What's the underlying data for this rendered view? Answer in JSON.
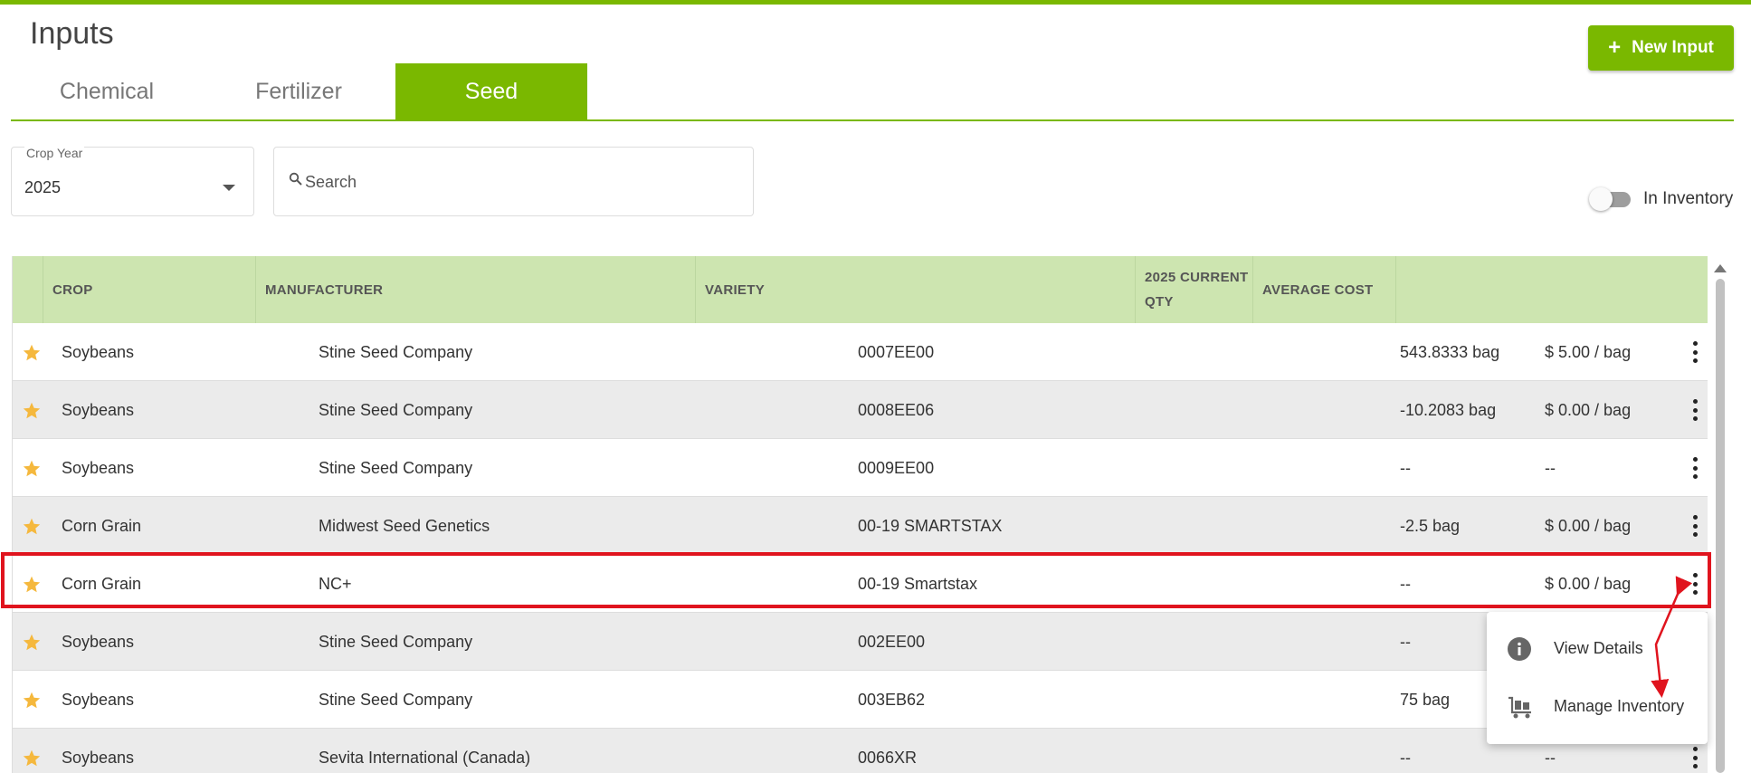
{
  "page": {
    "title": "Inputs"
  },
  "header": {
    "new_button_label": "New Input"
  },
  "tabs": [
    {
      "label": "Chemical",
      "active": false
    },
    {
      "label": "Fertilizer",
      "active": false
    },
    {
      "label": "Seed",
      "active": true
    }
  ],
  "filters": {
    "crop_year_label": "Crop Year",
    "crop_year_value": "2025",
    "search_placeholder": "Search",
    "in_inventory_label": "In Inventory",
    "in_inventory_on": false
  },
  "table": {
    "headers": {
      "crop": "CROP",
      "manufacturer": "MANUFACTURER",
      "variety": "VARIETY",
      "qty_line1": "2025 CURRENT",
      "qty_line2": "QTY",
      "avg_cost": "AVERAGE COST"
    },
    "rows": [
      {
        "crop": "Soybeans",
        "manufacturer": "Stine Seed Company",
        "variety": "0007EE00",
        "qty": "543.8333 bag",
        "cost": "$ 5.00 / bag"
      },
      {
        "crop": "Soybeans",
        "manufacturer": "Stine Seed Company",
        "variety": "0008EE06",
        "qty": "-10.2083 bag",
        "cost": "$ 0.00 / bag"
      },
      {
        "crop": "Soybeans",
        "manufacturer": "Stine Seed Company",
        "variety": "0009EE00",
        "qty": "--",
        "cost": "--"
      },
      {
        "crop": "Corn Grain",
        "manufacturer": "Midwest Seed Genetics",
        "variety": "00-19 SMARTSTAX",
        "qty": "-2.5 bag",
        "cost": "$ 0.00 / bag"
      },
      {
        "crop": "Corn Grain",
        "manufacturer": "NC+",
        "variety": "00-19 Smartstax",
        "qty": "--",
        "cost": "$ 0.00 / bag"
      },
      {
        "crop": "Soybeans",
        "manufacturer": "Stine Seed Company",
        "variety": "002EE00",
        "qty": "--",
        "cost": ""
      },
      {
        "crop": "Soybeans",
        "manufacturer": "Stine Seed Company",
        "variety": "003EB62",
        "qty": "75 bag",
        "cost": ""
      },
      {
        "crop": "Soybeans",
        "manufacturer": "Sevita International (Canada)",
        "variety": "0066XR",
        "qty": "--",
        "cost": "--"
      }
    ]
  },
  "context_menu": {
    "items": [
      {
        "label": "View Details",
        "icon": "info-icon"
      },
      {
        "label": "Manage Inventory",
        "icon": "inventory-cart-icon"
      }
    ]
  },
  "colors": {
    "brand_green": "#7ab800",
    "header_green": "#cde5b0",
    "star": "#f5b83d",
    "highlight_red": "#e0141e"
  }
}
